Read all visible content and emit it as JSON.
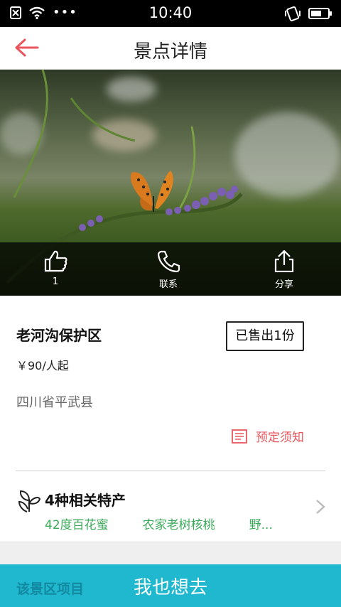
{
  "status_bar": {
    "time": "10:40"
  },
  "app_bar": {
    "title": "景点详情",
    "back_icon": "back-arrow-icon"
  },
  "hero": {
    "actions": [
      {
        "icon": "thumbs-up-icon",
        "label": "1"
      },
      {
        "icon": "phone-icon",
        "label": "联系"
      },
      {
        "icon": "share-icon",
        "label": "分享"
      }
    ]
  },
  "detail": {
    "name": "老河沟保护区",
    "sold_badge": "已售出1份",
    "price": "￥90/人起",
    "address": "四川省平武县",
    "notice_label": "预定须知"
  },
  "specialties": {
    "heading": "4种相关特产",
    "items": [
      "42度百花蜜",
      "农家老树核桃",
      "野..."
    ]
  },
  "bottom": {
    "under_label": "该景区项目",
    "go_button": "我也想去"
  },
  "colors": {
    "accent_red": "#e8555c",
    "teal": "#1fb8cf",
    "green": "#3aaa5a"
  }
}
